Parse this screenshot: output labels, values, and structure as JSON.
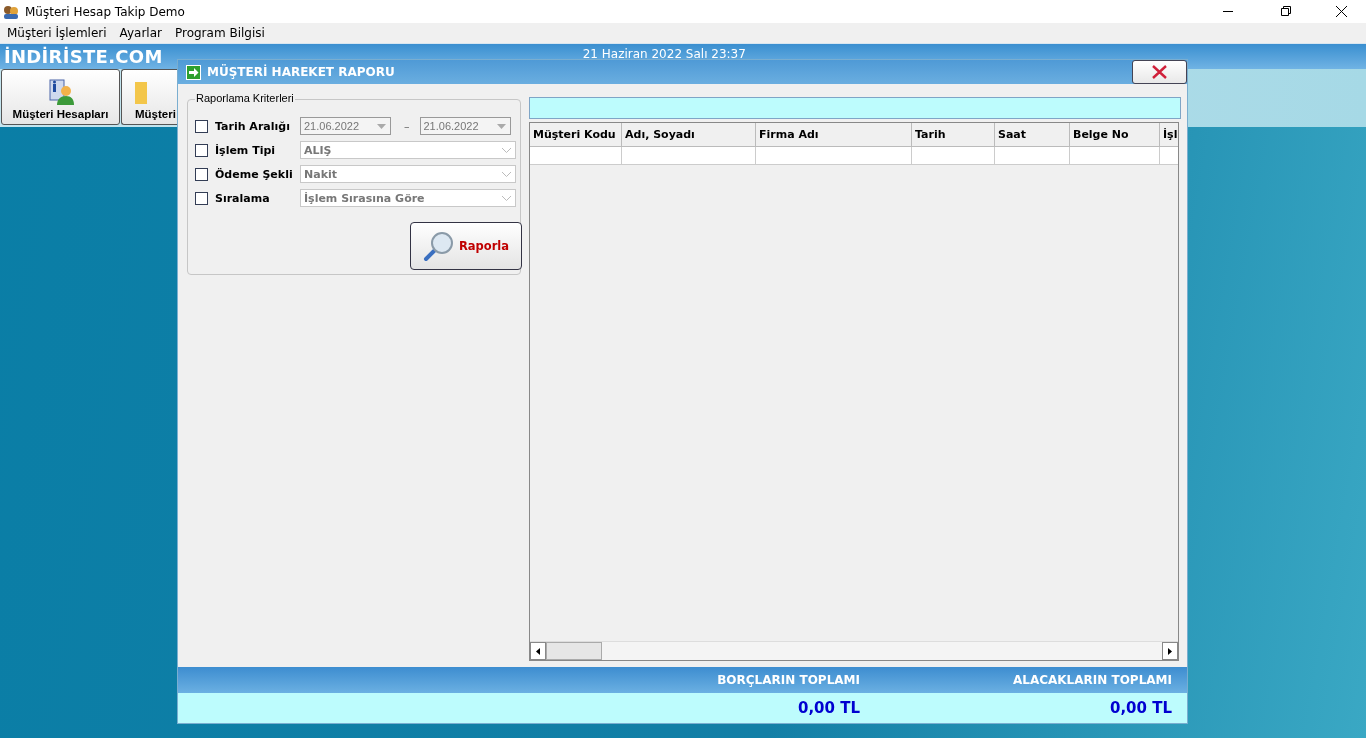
{
  "window": {
    "title": "Müşteri Hesap Takip Demo"
  },
  "menu": [
    {
      "label": "Müşteri İşlemleri"
    },
    {
      "label": "Ayarlar"
    },
    {
      "label": "Program Bilgisi"
    }
  ],
  "header": {
    "logo": "İNDİRİSTE.COM",
    "datetime": "21 Haziran 2022 Salı 23:37"
  },
  "toolbar": [
    {
      "label": "Müşteri Hesapları",
      "kind": "customers"
    },
    {
      "label": "Müşteri",
      "kind": "folder"
    }
  ],
  "dialog": {
    "title": "MÜŞTERİ HAREKET RAPORU",
    "criteria": {
      "legend": "Raporlama Kriterleri",
      "rows": [
        {
          "kind": "date-range",
          "label": "Tarih Aralığı",
          "checked": false,
          "disabled": true,
          "from": "21.06.2022",
          "separator": "–",
          "to": "21.06.2022"
        },
        {
          "kind": "combo",
          "label": "İşlem Tipi",
          "checked": false,
          "disabled": true,
          "value": "ALIŞ"
        },
        {
          "kind": "combo",
          "label": "Ödeme Şekli",
          "checked": false,
          "disabled": true,
          "value": "Nakit"
        },
        {
          "kind": "combo",
          "label": "Sıralama",
          "checked": false,
          "disabled": true,
          "value": "İşlem Sırasına Göre"
        }
      ]
    },
    "report_button": "Raporla",
    "table": {
      "columns": [
        "Müşteri Kodu",
        "Adı, Soyadı",
        "Firma Adı",
        "Tarih",
        "Saat",
        "Belge No",
        "İşl"
      ]
    },
    "totals": [
      {
        "label": "BORÇLARIN TOPLAMI",
        "value": "0,00 TL"
      },
      {
        "label": "ALACAKLARIN TOPLAMI",
        "value": "0,00 TL"
      }
    ]
  }
}
